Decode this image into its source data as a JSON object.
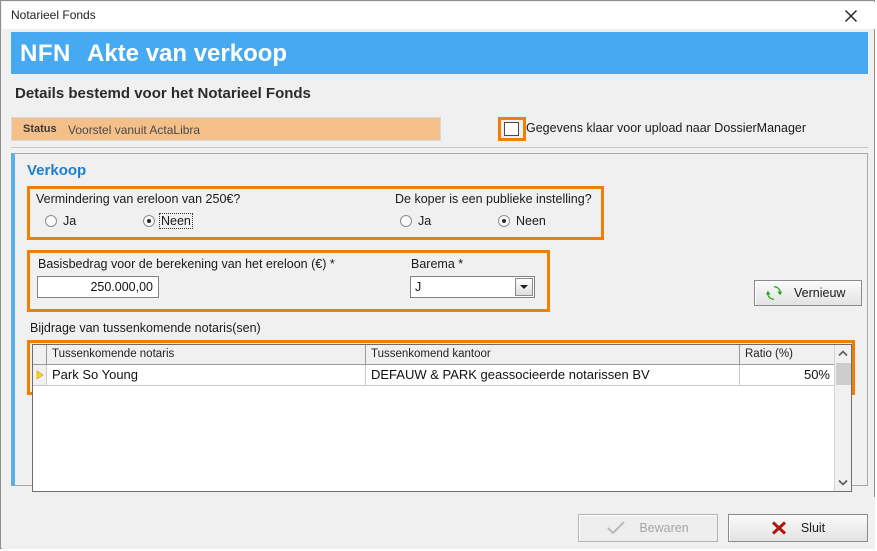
{
  "window": {
    "title": "Notarieel Fonds",
    "close_icon": "close-icon"
  },
  "banner": {
    "code": "NFN",
    "title": "Akte van verkoop"
  },
  "subtitle": "Details bestemd voor het Notarieel Fonds",
  "status": {
    "label": "Status",
    "value": "Voorstel vanuit ActaLibra",
    "background_color": "#f4bf88"
  },
  "upload": {
    "checkbox_checked": false,
    "label": "Gegevens klaar voor upload naar DossierManager"
  },
  "panel": {
    "title": "Verkoop",
    "questions": [
      {
        "label": "Vermindering van ereloon van 250€?",
        "options": [
          {
            "label": "Ja",
            "selected": false,
            "focused": false
          },
          {
            "label": "Neen",
            "selected": true,
            "focused": true
          }
        ]
      },
      {
        "label": "De koper is een publieke instelling?",
        "options": [
          {
            "label": "Ja",
            "selected": false,
            "focused": false
          },
          {
            "label": "Neen",
            "selected": true,
            "focused": false
          }
        ]
      }
    ],
    "amount": {
      "label": "Basisbedrag voor de berekening van het ereloon (€) *",
      "value": "250.000,00"
    },
    "barema": {
      "label": "Barema *",
      "value": "J"
    },
    "refresh_button": {
      "label": "Vernieuw",
      "icon": "refresh-icon"
    },
    "table": {
      "caption": "Bijdrage van tussenkomende notaris(sen)",
      "columns": [
        "",
        "Tussenkomende notaris",
        "Tussenkomend kantoor",
        "Ratio (%)"
      ],
      "rows": [
        {
          "indicator": "current-row-arrow",
          "notaris": "Park So Young",
          "kantoor": "DEFAUW & PARK geassocieerde notarissen BV",
          "ratio": "50%"
        }
      ]
    }
  },
  "footer": {
    "save_label": "Bewaren",
    "save_icon": "check-icon",
    "save_disabled": true,
    "close_label": "Sluit",
    "close_icon": "x-icon"
  },
  "colors": {
    "banner_blue": "#46aaf2",
    "highlight_orange": "#f08000",
    "status_peach": "#f4bf88",
    "panel_accent": "#5aaeea",
    "refresh_green": "#19a519",
    "close_red": "#b01414",
    "row_arrow_yellow": "#ffd11a"
  }
}
